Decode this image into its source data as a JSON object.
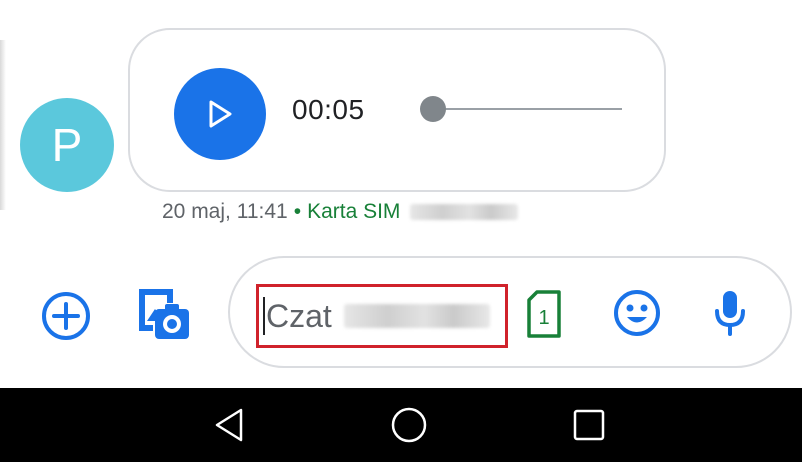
{
  "conversation": {
    "avatar_letter": "P",
    "audio_message": {
      "duration": "00:05",
      "progress": 0.0
    },
    "timestamp": "20 maj, 11:41",
    "separator": "•",
    "sim_label": "Karta SIM"
  },
  "composer": {
    "placeholder": "Czat",
    "sim_badge": "1"
  },
  "icons": {
    "add": "plus-circle-icon",
    "gallery": "gallery-camera-icon",
    "play": "play-icon",
    "sim": "sim-card-icon",
    "emoji": "smiley-icon",
    "mic": "microphone-icon",
    "back": "back-triangle-icon",
    "home": "home-circle-icon",
    "recents": "recents-square-icon"
  },
  "colors": {
    "accent_blue": "#1a73e8",
    "sim_green": "#188038",
    "avatar_teal": "#5bc8dc",
    "highlight_red": "#d0222b",
    "nav_bar": "#000000"
  }
}
